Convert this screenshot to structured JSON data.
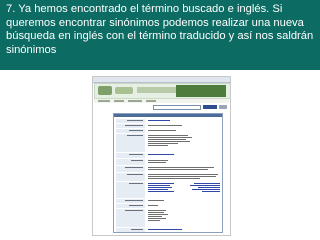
{
  "slide": {
    "caption": "7. Ya hemos encontrado el término buscado e inglés. Si queremos encontrar sinónimos podemos realizar una nueva búsqueda en inglés con el término traducido y así nos saldrán sinónimos",
    "background_color": "#0c6b62",
    "text_color": "#ffffff"
  },
  "screenshot": {
    "description_icon": "browser-window",
    "banner_colors": {
      "accent": "#4d7c3c",
      "table_header": "#4c6d99",
      "link": "#2d48a8"
    }
  }
}
